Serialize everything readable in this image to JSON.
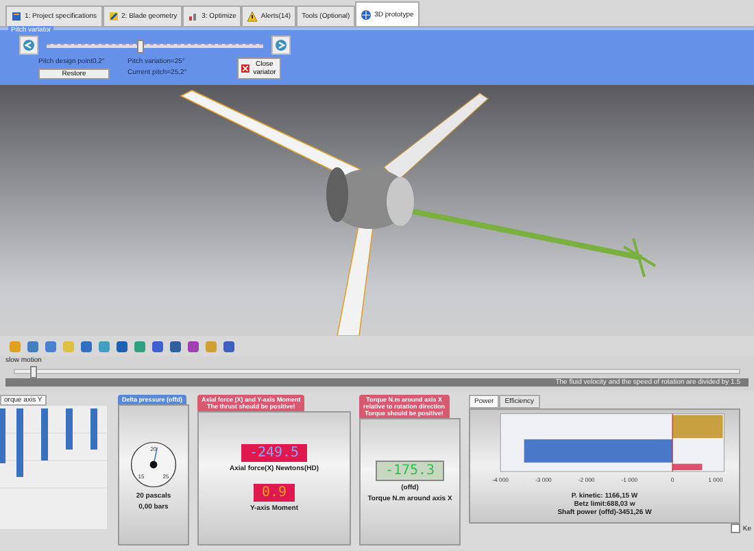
{
  "tabs": [
    {
      "label": "1: Project specifications",
      "kind": "spec",
      "selected": false
    },
    {
      "label": "2: Blade geometry",
      "kind": "blade",
      "selected": false
    },
    {
      "label": "3: Optimize",
      "kind": "optimize",
      "selected": false
    },
    {
      "label": "Alerts(14)",
      "kind": "alert",
      "selected": false
    },
    {
      "label": "Tools (Optional)",
      "kind": "none",
      "selected": false
    },
    {
      "label": "3D prototype",
      "kind": "globe",
      "selected": true
    }
  ],
  "pitch_variator": {
    "title": "Pitch variator",
    "level": 0.42,
    "design_point": "Pitch design point0,2°",
    "restore": "Restore",
    "variation": "Pitch variation=25°",
    "current": "Current pitch=25,2°",
    "close": "Close variator"
  },
  "slow_motion": {
    "label": "slow motion",
    "level": 0.02
  },
  "status": "The fluid velocity and the speed of rotation are divided by 1.5",
  "torque_y": {
    "tab": "orque axis Y"
  },
  "delta_pressure": {
    "tab": "Delta pressure (offd)",
    "ticks": [
      "20",
      "15",
      "25"
    ],
    "reading": "20 pascals",
    "bars": "0,00 bars"
  },
  "axial": {
    "tab": [
      "Axial force (X) and Y-axis Moment",
      "The thrust should be positive!"
    ],
    "force": "-249.5",
    "force_label": "Axial force(X) Newtons(HD)",
    "moment": "0.9",
    "moment_label": "Y-axis Moment"
  },
  "torque_x": {
    "tab": [
      "Torque N.m around axis X",
      "relative to rotation direction",
      "Torque should be positive!"
    ],
    "value": "-175.3",
    "unit": "(offd)",
    "label": "Torque N.m around axis X"
  },
  "power": {
    "tabs": [
      {
        "label": "Power",
        "selected": true
      },
      {
        "label": "Efficiency",
        "selected": false
      }
    ],
    "chart_data": {
      "type": "bar",
      "orientation": "horizontal",
      "xlim": [
        -4000,
        1200
      ],
      "ref_lines": [
        {
          "axis": "x",
          "value": 0,
          "color": "#d02020"
        }
      ],
      "xticks": [
        {
          "value": -4000,
          "label": "-4 000"
        },
        {
          "value": -3000,
          "label": "-3 000"
        },
        {
          "value": -2000,
          "label": "-2 000"
        },
        {
          "value": -1000,
          "label": "-1 000"
        },
        {
          "value": 0,
          "label": "0"
        },
        {
          "value": 1000,
          "label": "1 000"
        }
      ],
      "series": [
        {
          "color": "#c8a040",
          "values": [
            1170
          ]
        },
        {
          "color": "#4a78c8",
          "values": [
            -3450
          ]
        },
        {
          "color": "#e0506e",
          "values": [
            690
          ]
        }
      ]
    },
    "lines": [
      "P. kinetic: 1166,15 W",
      "Betz limit:688,03 w",
      "Shaft power (offd)-3451,26 W"
    ],
    "checkbox": {
      "label": "Ke",
      "checked": false
    }
  }
}
